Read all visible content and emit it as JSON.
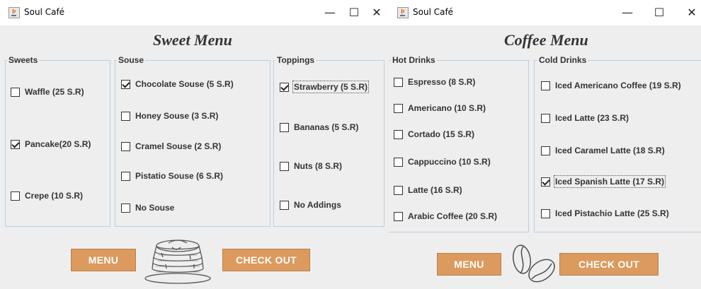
{
  "left_window": {
    "title": "Soul Café",
    "controls": {
      "minimize": "—",
      "maximize": "☐",
      "close": "✕"
    },
    "heading": "Sweet Menu",
    "groups": {
      "sweets": {
        "title": "Sweets",
        "items": [
          {
            "label": "Waffle (25 S.R)",
            "checked": false
          },
          {
            "label": "Pancake(20 S.R)",
            "checked": true
          },
          {
            "label": "Crepe (10 S.R)",
            "checked": false
          }
        ]
      },
      "souse": {
        "title": "Souse",
        "items": [
          {
            "label": "Chocolate Souse (5 S.R)",
            "checked": true
          },
          {
            "label": "Honey Souse (3 S.R)",
            "checked": false
          },
          {
            "label": "Cramel Souse (2 S.R)",
            "checked": false
          },
          {
            "label": "Pistatio Souse (6 S.R)",
            "checked": false
          },
          {
            "label": "No Souse",
            "checked": false
          }
        ]
      },
      "toppings": {
        "title": "Toppings",
        "items": [
          {
            "label": "Strawberry (5 S.R)",
            "checked": true
          },
          {
            "label": "Bananas (5 S.R)",
            "checked": false
          },
          {
            "label": "Nuts (8 S.R)",
            "checked": false
          },
          {
            "label": "No Addings",
            "checked": false
          }
        ]
      }
    },
    "buttons": {
      "menu": "MENU",
      "checkout": "CHECK OUT"
    },
    "image_icon": "pancake-stack-icon"
  },
  "right_window": {
    "title": "Soul Café",
    "controls": {
      "minimize": "—",
      "maximize": "☐",
      "close": "✕"
    },
    "heading": "Coffee Menu",
    "groups": {
      "hot": {
        "title": "Hot Drinks",
        "items": [
          {
            "label": "Espresso (8 S.R)",
            "checked": false
          },
          {
            "label": "Americano (10 S.R)",
            "checked": false
          },
          {
            "label": "Cortado (15 S.R)",
            "checked": false
          },
          {
            "label": "Cappuccino (10 S.R)",
            "checked": false
          },
          {
            "label": "Latte (16 S.R)",
            "checked": false
          },
          {
            "label": "Arabic Coffee (20 S.R)",
            "checked": false
          }
        ]
      },
      "cold": {
        "title": "Cold Drinks",
        "items": [
          {
            "label": "Iced Americano Coffee (19 S.R)",
            "checked": false
          },
          {
            "label": "Iced Latte (23 S.R)",
            "checked": false
          },
          {
            "label": "Iced Caramel Latte (18 S.R)",
            "checked": false
          },
          {
            "label": "Iced Spanish Latte (17 S.R)",
            "checked": true
          },
          {
            "label": "Iced Pistachio Latte (25 S.R)",
            "checked": false
          }
        ]
      }
    },
    "buttons": {
      "menu": "MENU",
      "checkout": "CHECK OUT"
    },
    "image_icon": "coffee-beans-icon"
  },
  "colors": {
    "button": "#dc9a5e",
    "group_border": "#b8cfe5",
    "window_bg": "#eeeeee"
  }
}
